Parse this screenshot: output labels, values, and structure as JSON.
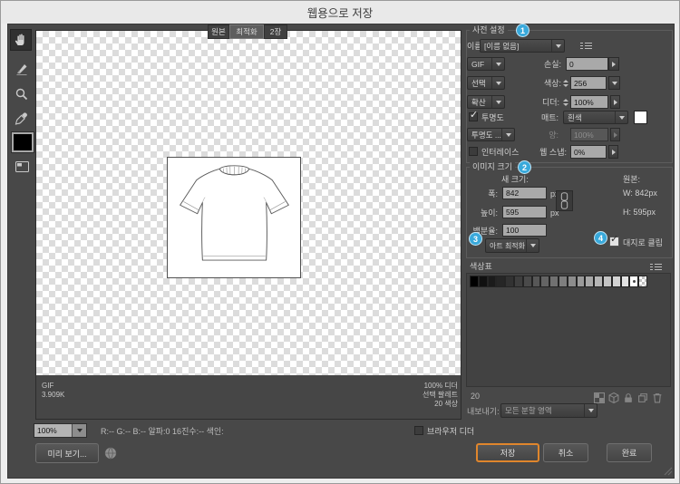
{
  "window": {
    "title": "웹용으로 저장"
  },
  "tabs": {
    "original": "원본",
    "optimized": "최적화",
    "two_up": "2장",
    "active": "최적화"
  },
  "toolbar": {
    "tools": [
      "hand",
      "slice-select",
      "zoom",
      "eyedropper",
      "foreground-color",
      "toggle-slices-visibility"
    ],
    "color": "#000000"
  },
  "preset": {
    "label": "사전 설정",
    "badge": "1",
    "name_label": "이름:",
    "name_value": "[이름 없음]",
    "format": "GIF",
    "lossy_label": "손실:",
    "lossy_value": "0",
    "palette": "선택",
    "colors_label": "색상:",
    "colors_value": "256",
    "dither_method": "확산",
    "dither_label": "디더:",
    "dither_value": "100%",
    "transparency_label": "투명도",
    "transparency_checked": true,
    "matte_label": "매트:",
    "matte_value": "흰색",
    "matte_color": "#ffffff",
    "transparency_dither": "투명도 ...",
    "amount_label": "양:",
    "amount_value": "100%",
    "interlaced_label": "인터레이스",
    "interlaced_checked": false,
    "web_snap_label": "웹 스냅:",
    "web_snap_value": "0%"
  },
  "image_size": {
    "label": "이미지 크기",
    "badge": "2",
    "new_size_label": "새 크기:",
    "width_label": "폭:",
    "width_value": "842",
    "height_label": "높이:",
    "height_value": "595",
    "unit": "px",
    "percent_label": "백분율:",
    "percent_value": "100",
    "original_label": "원본:",
    "original_width": "W: 842px",
    "original_height": "H: 595px",
    "quality_badge": "3",
    "quality_value": "아트 최적화",
    "clip_badge": "4",
    "clip_label": "대지로 클립",
    "clip_checked": true
  },
  "color_table": {
    "label": "색상표",
    "count": "20",
    "swatches": [
      "#000000",
      "#101010",
      "#1b1b1b",
      "#262626",
      "#323232",
      "#3e3e3e",
      "#4a4a4a",
      "#575757",
      "#646464",
      "#717171",
      "#7e7e7e",
      "#8c8c8c",
      "#9a9a9a",
      "#a8a8a8",
      "#b6b6b6",
      "#c4c4c4",
      "#d3d3d3",
      "#e2e2e2",
      "#ffffff",
      "transparent"
    ],
    "marked_swatch_index": 18
  },
  "export_row": {
    "label": "내보내기:",
    "value": "모든 분할 영역"
  },
  "preview": {
    "format": "GIF",
    "file_size": "3.909K",
    "info": [
      "100% 디더",
      "선택 팔레트",
      "20 색상"
    ]
  },
  "status_bar": {
    "zoom": "100%",
    "readout": "R:-- G:-- B:-- 알파:0  16진수:-- 색인:",
    "browser_dither_label": "브라우저 디더",
    "browser_dither_checked": false,
    "preview_button": "미리 보기..."
  },
  "buttons": {
    "save": "저장",
    "cancel": "취소",
    "done": "완료"
  },
  "colors": {
    "accent": "#e0862c",
    "badge": "#39a9db"
  }
}
